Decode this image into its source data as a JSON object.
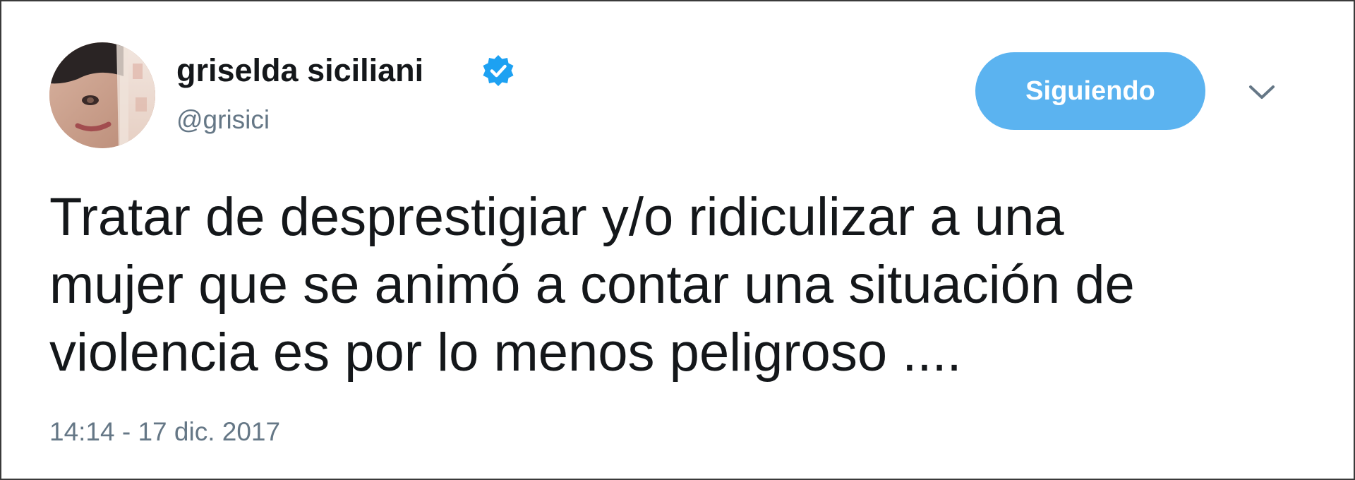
{
  "tweet": {
    "author": {
      "name": "griselda siciliani",
      "handle": "@grisici",
      "verified": true
    },
    "follow_button_label": "Siguiendo",
    "text_lines": [
      "Tratar de desprestigiar y/o ridiculizar a una",
      "mujer que se animó a contar una situación de",
      "violencia es por lo menos peligroso ...."
    ],
    "timestamp": "14:14 - 17 dic. 2017"
  },
  "colors": {
    "accent": "#5bb3f0",
    "verified_badge": "#1da1f2",
    "text_primary": "#14171a",
    "text_secondary": "#657786",
    "border": "#3a3a3a"
  },
  "icons": {
    "verified": "verified-badge-icon",
    "menu": "chevron-down-icon"
  }
}
